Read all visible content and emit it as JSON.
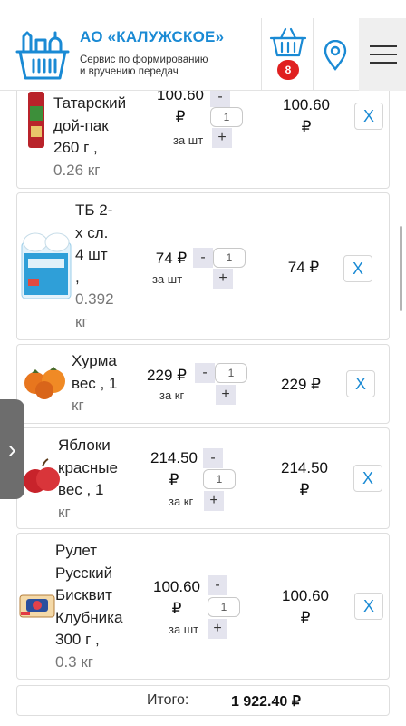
{
  "header": {
    "brand_title": "АО «КАЛУЖСКОЕ»",
    "brand_subtitle_line1": "Сервис по формированию",
    "brand_subtitle_line2": "и вручению передач",
    "cart_count": "8",
    "brand_color": "#1a8ad4",
    "badge_color": "#e02020",
    "icons": [
      "basket-logo-icon",
      "cart-icon",
      "location-pin-icon",
      "hamburger-menu-icon"
    ]
  },
  "cart": {
    "items": [
      {
        "name_lines": [
          "Татарский",
          "дой-пак",
          "260 г ,"
        ],
        "weight": "0.26 кг",
        "price_lines": [
          "100.60",
          "₽"
        ],
        "unit": "за шт",
        "quantity": "1",
        "total_lines": [
          "100.60",
          "₽"
        ],
        "minus": "-",
        "plus": "+",
        "remove": "X",
        "image": "ketchup-pack-image"
      },
      {
        "name_lines": [
          "ТБ 2-",
          "х сл.",
          "4 шт",
          ","
        ],
        "weight_lines": [
          "0.392",
          "кг"
        ],
        "price": "74 ₽",
        "unit": "за шт",
        "quantity": "1",
        "total": "74 ₽",
        "minus": "-",
        "plus": "+",
        "remove": "X",
        "image": "toilet-paper-image"
      },
      {
        "name_lines": [
          "Хурма",
          "вес , 1"
        ],
        "weight": "кг",
        "price": "229 ₽",
        "unit": "за кг",
        "quantity": "1",
        "total": "229 ₽",
        "minus": "-",
        "plus": "+",
        "remove": "X",
        "image": "persimmon-image"
      },
      {
        "name_lines": [
          "Яблоки",
          "красные",
          "вес , 1"
        ],
        "weight": "кг",
        "price_lines": [
          "214.50",
          "₽"
        ],
        "unit": "за кг",
        "quantity": "1",
        "total_lines": [
          "214.50",
          "₽"
        ],
        "minus": "-",
        "plus": "+",
        "remove": "X",
        "image": "red-apples-image"
      },
      {
        "name_lines": [
          "Рулет",
          "Русский",
          "Бисквит",
          "Клубника",
          "300 г ,"
        ],
        "weight": "0.3 кг",
        "price_lines": [
          "100.60",
          "₽"
        ],
        "unit": "за шт",
        "quantity": "1",
        "total_lines": [
          "100.60",
          "₽"
        ],
        "minus": "-",
        "plus": "+",
        "remove": "X",
        "image": "sponge-roll-image"
      }
    ],
    "summary": {
      "label": "Итого:",
      "value": "1 922.40 ₽"
    }
  },
  "side_tab": {
    "label": "›"
  }
}
